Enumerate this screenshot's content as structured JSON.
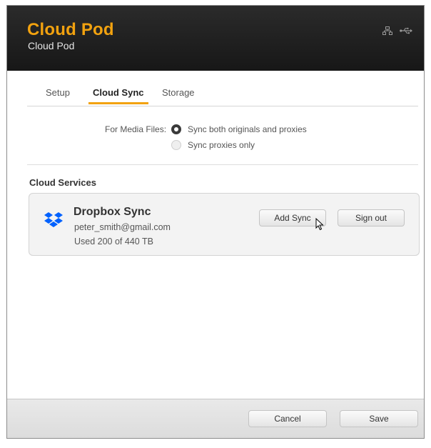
{
  "header": {
    "title": "Cloud Pod",
    "subtitle": "Cloud Pod",
    "icons": [
      "network-icon",
      "usb-icon"
    ]
  },
  "tabs": [
    {
      "label": "Setup",
      "active": false
    },
    {
      "label": "Cloud Sync",
      "active": true
    },
    {
      "label": "Storage",
      "active": false
    }
  ],
  "media_files": {
    "label": "For Media Files:",
    "options": [
      {
        "label": "Sync both originals and proxies",
        "selected": true
      },
      {
        "label": "Sync proxies only",
        "selected": false
      }
    ]
  },
  "cloud_services": {
    "title": "Cloud Services",
    "service": {
      "icon": "dropbox-icon",
      "name": "Dropbox Sync",
      "email": "peter_smith@gmail.com",
      "usage": "Used 200 of 440 TB",
      "add_sync_label": "Add Sync",
      "sign_out_label": "Sign out"
    }
  },
  "footer": {
    "cancel_label": "Cancel",
    "save_label": "Save"
  },
  "colors": {
    "accent": "#f2a20f",
    "header_bg": "#1f1f1f",
    "dropbox_blue": "#0061fe"
  }
}
